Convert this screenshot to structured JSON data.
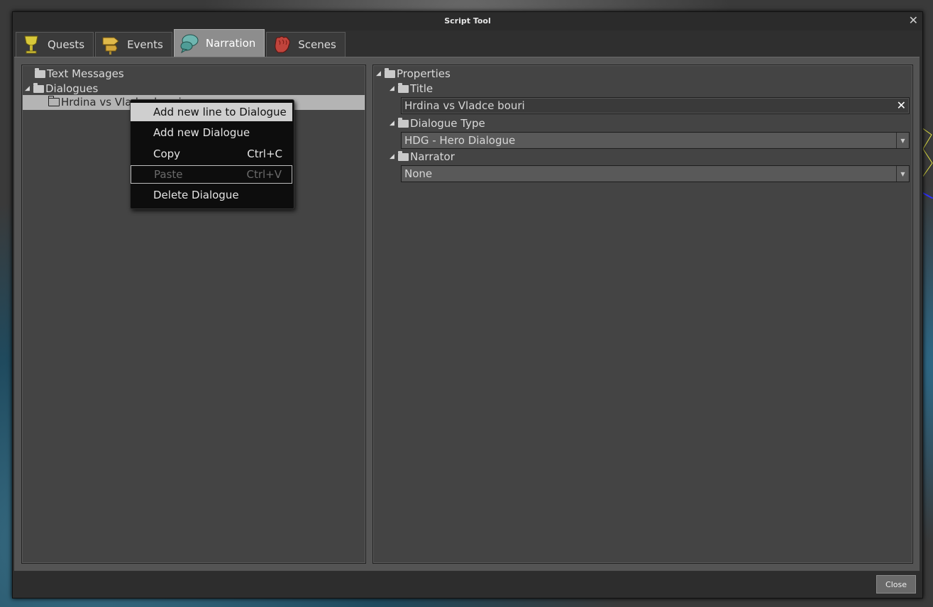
{
  "window": {
    "title": "Script Tool",
    "close_glyph": "✕"
  },
  "tabs": [
    {
      "label": "Quests",
      "icon": "goblet-icon",
      "color": "#d8c83a"
    },
    {
      "label": "Events",
      "icon": "signpost-icon",
      "color": "#e0b94a"
    },
    {
      "label": "Narration",
      "icon": "speech-bubbles-icon",
      "color": "#6fb6b0"
    },
    {
      "label": "Scenes",
      "icon": "fist-icon",
      "color": "#c0443c"
    }
  ],
  "active_tab": "Narration",
  "left_tree": {
    "text_messages": "Text Messages",
    "dialogues": "Dialogues",
    "selected_item": "Hrdina vs Vladce bouri"
  },
  "context_menu": {
    "items": [
      {
        "label": "Add new line to Dialogue",
        "shortcut": ""
      },
      {
        "label": "Add new Dialogue",
        "shortcut": ""
      },
      {
        "label": "Copy",
        "shortcut": "Ctrl+C"
      },
      {
        "label": "Paste",
        "shortcut": "Ctrl+V"
      },
      {
        "label": "Delete Dialogue",
        "shortcut": ""
      }
    ]
  },
  "properties": {
    "root": "Properties",
    "title_label": "Title",
    "title_value": "Hrdina vs Vladce bouri",
    "dialogue_type_label": "Dialogue Type",
    "dialogue_type_value": "HDG - Hero Dialogue",
    "narrator_label": "Narrator",
    "narrator_value": "None"
  },
  "footer": {
    "close_label": "Close"
  }
}
